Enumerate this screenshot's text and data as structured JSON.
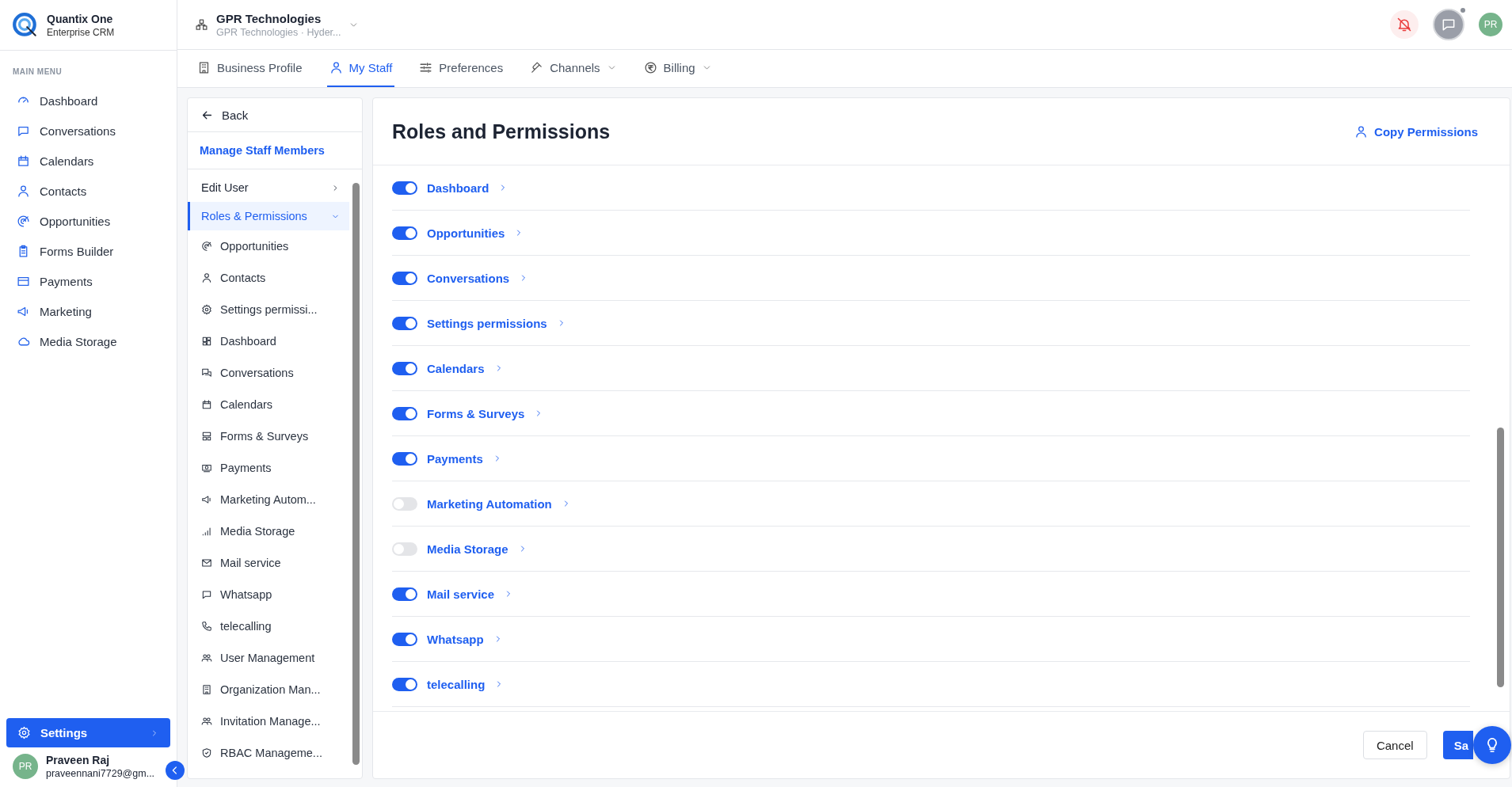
{
  "brand": {
    "name": "Quantix One",
    "subtitle": "Enterprise CRM"
  },
  "org": {
    "name": "GPR Technologies",
    "subtitle": "GPR Technologies · Hyder..."
  },
  "header": {
    "avatar": "PR",
    "whatsapp_dot": true
  },
  "sidebar": {
    "section": "MAIN MENU",
    "items": [
      {
        "label": "Dashboard",
        "selected": false
      },
      {
        "label": "Conversations",
        "selected": false
      },
      {
        "label": "Calendars",
        "selected": false
      },
      {
        "label": "Contacts",
        "selected": false
      },
      {
        "label": "Opportunities",
        "selected": false
      },
      {
        "label": "Forms Builder",
        "selected": false
      },
      {
        "label": "Payments",
        "selected": false
      },
      {
        "label": "Marketing",
        "selected": false
      },
      {
        "label": "Media Storage",
        "selected": false
      }
    ],
    "settings": {
      "label": "Settings",
      "selected": true
    },
    "user": {
      "avatar": "PR",
      "name": "Praveen Raj",
      "email": "praveennani7729@gm..."
    }
  },
  "tabs": [
    {
      "label": "Business Profile",
      "selected": false,
      "dropdown": false
    },
    {
      "label": "My Staff",
      "selected": true,
      "dropdown": false
    },
    {
      "label": "Preferences",
      "selected": false,
      "dropdown": false
    },
    {
      "label": "Channels",
      "selected": false,
      "dropdown": true
    },
    {
      "label": "Billing",
      "selected": false,
      "dropdown": true
    }
  ],
  "subnav": {
    "back": "Back",
    "title": "Manage Staff Members",
    "sections": [
      {
        "label": "Edit User",
        "selected": false,
        "expanded": false
      },
      {
        "label": "Roles & Permissions",
        "selected": true,
        "expanded": true
      }
    ],
    "items": [
      "Opportunities",
      "Contacts",
      "Settings permissi...",
      "Dashboard",
      "Conversations",
      "Calendars",
      "Forms & Surveys",
      "Payments",
      "Marketing Autom...",
      "Media Storage",
      "Mail service",
      "Whatsapp",
      "telecalling",
      "User Management",
      "Organization Man...",
      "Invitation Manage...",
      "RBAC Manageme..."
    ]
  },
  "panel": {
    "title": "Roles and Permissions",
    "copy": "Copy Permissions",
    "permissions": [
      {
        "label": "Dashboard",
        "on": true
      },
      {
        "label": "Opportunities",
        "on": true
      },
      {
        "label": "Conversations",
        "on": true
      },
      {
        "label": "Settings permissions",
        "on": true
      },
      {
        "label": "Calendars",
        "on": true
      },
      {
        "label": "Forms & Surveys",
        "on": true
      },
      {
        "label": "Payments",
        "on": true
      },
      {
        "label": "Marketing Automation",
        "on": false
      },
      {
        "label": "Media Storage",
        "on": false
      },
      {
        "label": "Mail service",
        "on": true
      },
      {
        "label": "Whatsapp",
        "on": true
      },
      {
        "label": "telecalling",
        "on": true
      }
    ],
    "cancel": "Cancel",
    "save": "Sa"
  }
}
